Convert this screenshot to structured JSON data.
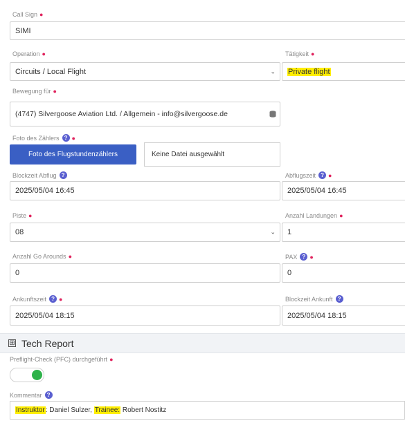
{
  "call_sign": {
    "label": "Call Sign",
    "value": "SIMI"
  },
  "operation": {
    "label": "Operation",
    "value": "Circuits / Local Flight"
  },
  "activity": {
    "label": "Tätigkeit",
    "value": "Private flight"
  },
  "movement": {
    "label": "Bewegung für",
    "value": "(4747) Silvergoose Aviation Ltd. / Allgemein - info@silvergoose.de"
  },
  "photo": {
    "label": "Foto des Zählers",
    "button": "Foto des Flugstundenzählers",
    "filename": "Keine Datei ausgewählt"
  },
  "block_departure": {
    "label": "Blockzeit Abflug",
    "value": "2025/05/04 16:45"
  },
  "takeoff_time": {
    "label": "Abflugszeit",
    "value": "2025/05/04 16:45"
  },
  "runway": {
    "label": "Piste",
    "value": "08"
  },
  "landings": {
    "label": "Anzahl Landungen",
    "value": "1"
  },
  "go_arounds": {
    "label": "Anzahl Go Arounds",
    "value": "0"
  },
  "pax": {
    "label": "PAX",
    "value": "0"
  },
  "arrival_time": {
    "label": "Ankunftszeit",
    "value": "2025/05/04 18:15"
  },
  "block_arrival": {
    "label": "Blockzeit Ankunft",
    "value": "2025/05/04 18:15"
  },
  "tech_report": {
    "title": "Tech Report",
    "toggle_symbol": "⊞"
  },
  "pfc": {
    "label": "Preflight-Check (PFC) durchgeführt",
    "checked": true
  },
  "comment": {
    "label": "Kommentar",
    "instructor_key": "Instruktor",
    "instructor_value": ": Daniel Sulzer, ",
    "trainee_key": "Trainee:",
    "trainee_value": " Robert Nostitz"
  },
  "common": {
    "required_mark": "●",
    "help_mark": "?",
    "chevron": "⌄"
  },
  "colors": {
    "accent": "#3a5fc4",
    "help": "#5a5fd0",
    "required": "#e0245e",
    "highlight": "#ffee00",
    "toggle_on": "#2eb24a"
  }
}
